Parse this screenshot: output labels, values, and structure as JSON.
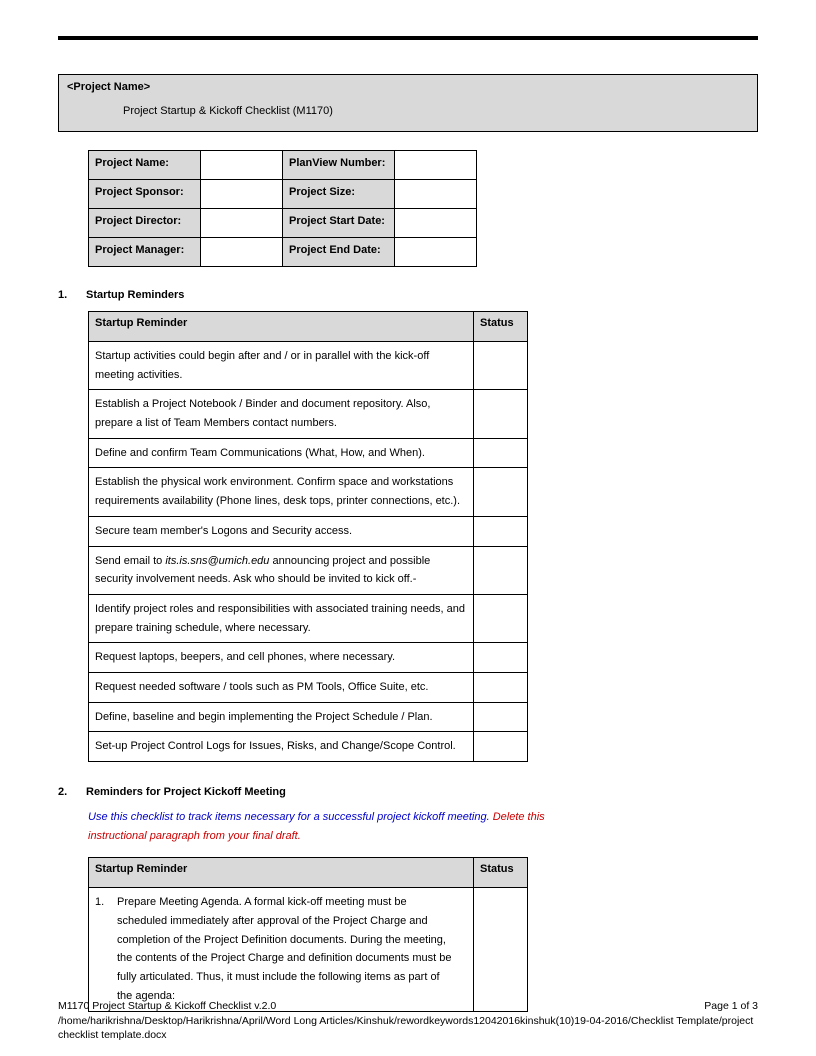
{
  "header": {
    "project_name_placeholder": "<Project Name>",
    "subtitle": "Project Startup & Kickoff Checklist (M1170)"
  },
  "info": {
    "rows": [
      {
        "l1": "Project Name:",
        "v1": "",
        "l2": "PlanView Number:",
        "v2": ""
      },
      {
        "l1": "Project Sponsor:",
        "v1": "",
        "l2": "Project Size:",
        "v2": ""
      },
      {
        "l1": "Project Director:",
        "v1": "",
        "l2": "Project Start Date:",
        "v2": ""
      },
      {
        "l1": "Project Manager:",
        "v1": "",
        "l2": "Project End Date:",
        "v2": ""
      }
    ]
  },
  "section1": {
    "num": "1.",
    "title": "Startup Reminders",
    "col_reminder": "Startup Reminder",
    "col_status": "Status",
    "items": [
      "Startup activities could begin after and / or in parallel with the kick-off meeting activities.",
      "Establish a Project Notebook / Binder and document repository. Also, prepare a list of Team Members contact numbers.",
      "Define and confirm Team Communications (What, How, and When).",
      "Establish the physical work environment. Confirm space and workstations requirements availability (Phone lines, desk tops, printer connections, etc.).",
      "Secure team member's Logons and Security access.",
      "",
      "Identify project roles and responsibilities with associated training needs, and prepare training schedule, where necessary.",
      "Request laptops, beepers, and cell phones, where necessary.",
      "Request needed software / tools such as PM Tools, Office Suite, etc.",
      "Define, baseline and begin implementing the Project Schedule / Plan.",
      "Set-up Project Control Logs for Issues, Risks, and Change/Scope Control."
    ],
    "email_item": {
      "pre": "Send email to ",
      "email": "its.is.sns@umich.edu",
      "post": " announcing project and possible security involvement needs.  Ask who should be invited to kick off.-"
    }
  },
  "section2": {
    "num": "2.",
    "title": "Reminders for Project Kickoff Meeting",
    "instruct_blue": "Use this checklist to track items necessary for a successful project kickoff meeting. ",
    "instruct_red": "Delete this instructional paragraph from your final draft.",
    "col_reminder": "Startup Reminder",
    "col_status": "Status",
    "item1_num": "1.",
    "item1_text": "Prepare Meeting Agenda. A formal kick-off meeting must be scheduled immediately after approval of the Project Charge and completion of the Project Definition documents. During the meeting, the contents of the Project Charge and definition documents must be fully articulated. Thus, it must include the following items as part of the agenda:"
  },
  "footer": {
    "line1_left": "M1170 Project Startup & Kickoff Checklist v.2.0",
    "line1_right": "Page 1 of 3",
    "line2": "/home/harikrishna/Desktop/Harikrishna/April/Word Long Articles/Kinshuk/rewordkeywords12042016kinshuk(10)19-04-2016/Checklist Template/project checklist template.docx"
  }
}
